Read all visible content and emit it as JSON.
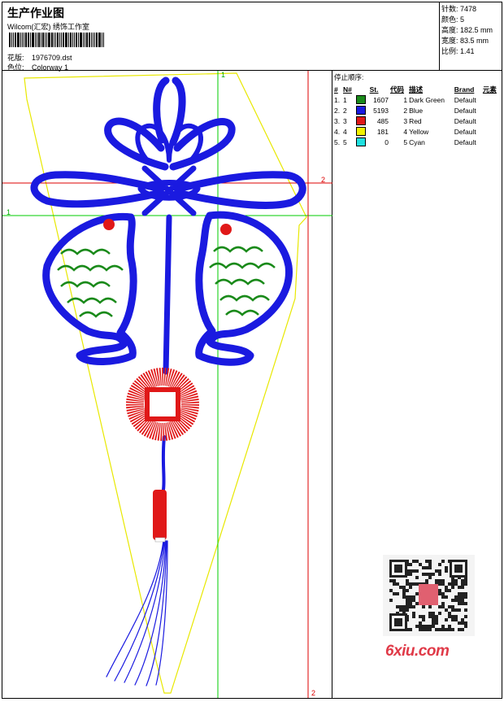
{
  "header": {
    "title": "生产作业图",
    "subtitle": "Wilcom(汇宏) 绣饰工作室",
    "design_label": "花版:",
    "design_value": "1976709.dst",
    "colorway_label": "色位:",
    "colorway_value": "Colorway 1"
  },
  "stats": {
    "stitches_label": "针数:",
    "stitches_value": "7478",
    "colors_label": "颜色:",
    "colors_value": "5",
    "height_label": "高度:",
    "height_value": "182.5 mm",
    "width_label": "宽度:",
    "width_value": "83.5 mm",
    "ratio_label": "比例:",
    "ratio_value": "1.41"
  },
  "guides": {
    "green_h_label": "1",
    "green_v_label": "1",
    "red_h_label": "2",
    "red_v_label": "2"
  },
  "legend": {
    "title": "停止顺序:",
    "columns": {
      "num": "#",
      "needle": "N#",
      "st": "St.",
      "code": "代码",
      "desc": "描述",
      "brand": "Brand",
      "elem": "元素"
    },
    "rows": [
      {
        "num": "1.",
        "needle": "1",
        "color": "#1a8a1a",
        "st": "1607",
        "code": "1",
        "desc": "Dark Green",
        "brand": "Default"
      },
      {
        "num": "2.",
        "needle": "2",
        "color": "#1a1ae0",
        "st": "5193",
        "code": "2",
        "desc": "Blue",
        "brand": "Default"
      },
      {
        "num": "3.",
        "needle": "3",
        "color": "#e01818",
        "st": "485",
        "code": "3",
        "desc": "Red",
        "brand": "Default"
      },
      {
        "num": "4.",
        "needle": "4",
        "color": "#f2f200",
        "st": "181",
        "code": "4",
        "desc": "Yellow",
        "brand": "Default"
      },
      {
        "num": "5.",
        "needle": "5",
        "color": "#20e0e0",
        "st": "0",
        "code": "5",
        "desc": "Cyan",
        "brand": "Default"
      }
    ]
  },
  "watermark": {
    "text": "6xiu.com"
  },
  "colors": {
    "blue": "#1a1ae0",
    "green": "#1a8a1a",
    "red": "#e01818",
    "yellow": "#e8e800",
    "guide_green": "#00cc00",
    "guide_red": "#dd0000"
  }
}
